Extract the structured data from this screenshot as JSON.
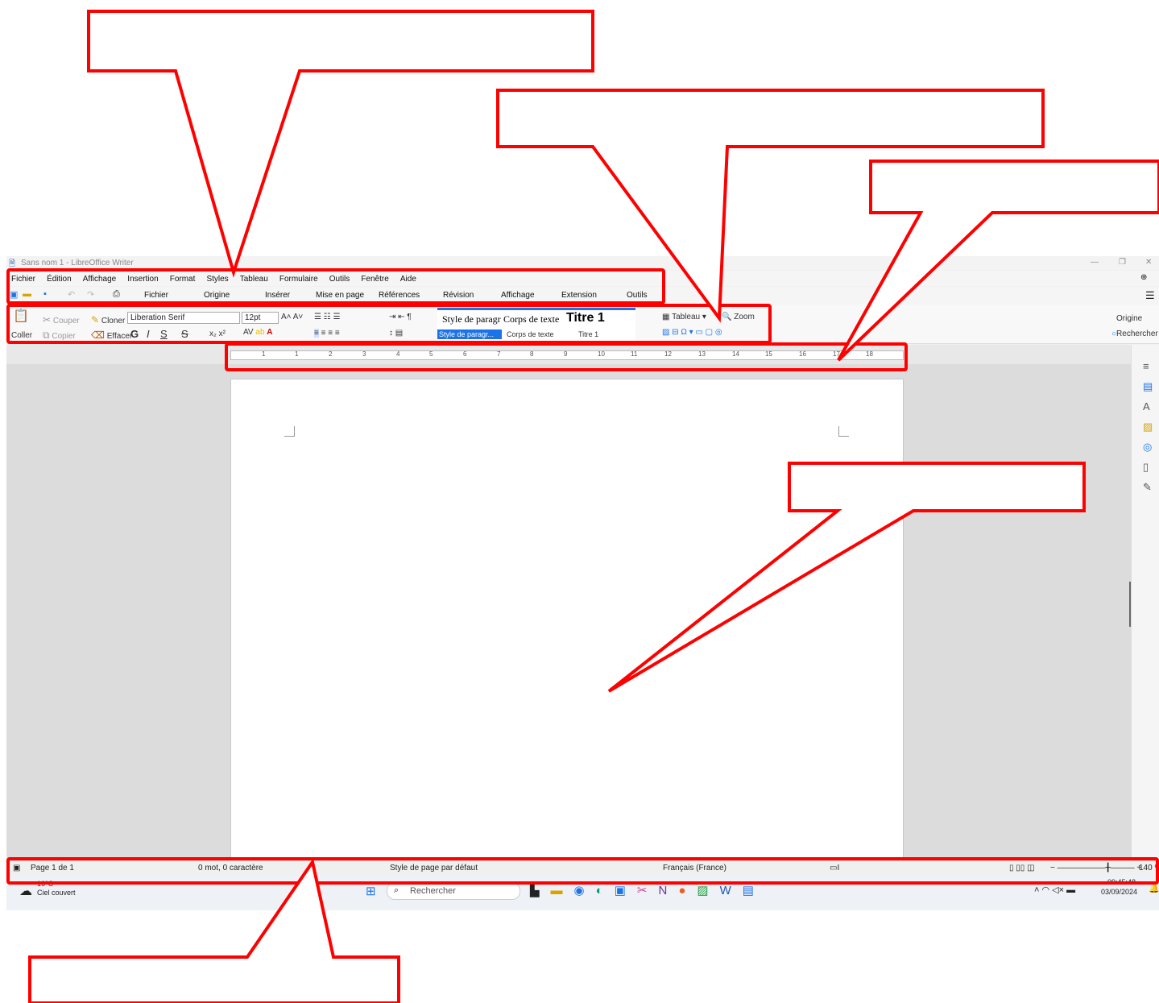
{
  "window": {
    "title": "Sans nom 1 - LibreOffice Writer",
    "controls": [
      "—",
      "❐",
      "✕"
    ]
  },
  "menubar": [
    "Fichier",
    "Édition",
    "Affichage",
    "Insertion",
    "Format",
    "Styles",
    "Tableau",
    "Formulaire",
    "Outils",
    "Fenêtre",
    "Aide"
  ],
  "tabs": [
    "Fichier",
    "Origine",
    "Insérer",
    "Mise en page",
    "Références",
    "Révision",
    "Affichage",
    "Extension",
    "Outils"
  ],
  "toolbar": {
    "paste": "Coller",
    "cut": "Couper",
    "copy": "Copier",
    "clone": "Cloner",
    "clear": "Effacer",
    "font_name": "Liberation Serif",
    "font_size": "12pt",
    "bold": "G",
    "italic": "I",
    "underline": "S",
    "strike": "S",
    "style_preview_1": "Style de paragr",
    "style_preview_2": "Corps de texte",
    "style_preview_3": "Titre 1",
    "style_label_1": "Style de paragr...",
    "style_label_2": "Corps de texte",
    "style_label_3": "Titre 1",
    "table": "Tableau",
    "zoom": "Zoom",
    "right_origin": "Origine",
    "right_search": "Rechercher"
  },
  "ruler_numbers": [
    "1",
    "1",
    "2",
    "3",
    "4",
    "5",
    "6",
    "7",
    "8",
    "9",
    "10",
    "11",
    "12",
    "13",
    "14",
    "15",
    "16",
    "17",
    "18"
  ],
  "status": {
    "page": "Page 1 de 1",
    "words": "0 mot, 0 caractère",
    "page_style": "Style de page par défaut",
    "language": "Français (France)",
    "zoom": "140 %"
  },
  "taskbar": {
    "weather_temp": "16°C",
    "weather_desc": "Ciel couvert",
    "search": "Rechercher",
    "time": "09:45:48",
    "date": "03/09/2024"
  },
  "colors": {
    "annotation": "#ff0000",
    "accent": "#1a73e8"
  }
}
